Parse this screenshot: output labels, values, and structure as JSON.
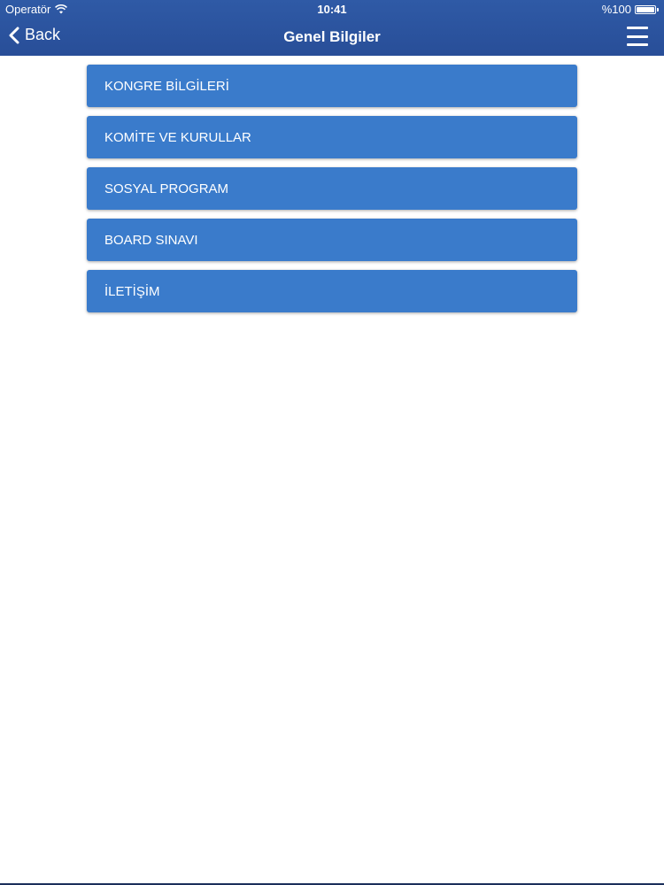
{
  "status_bar": {
    "carrier": "Operatör",
    "time": "10:41",
    "battery": "%100"
  },
  "nav": {
    "back_label": "Back",
    "title": "Genel Bilgiler"
  },
  "menu": {
    "items": [
      {
        "label": "KONGRE BİLGİLERİ"
      },
      {
        "label": "KOMİTE VE KURULLAR"
      },
      {
        "label": "SOSYAL PROGRAM"
      },
      {
        "label": "BOARD SINAVI"
      },
      {
        "label": "İLETİŞİM"
      }
    ]
  },
  "colors": {
    "header": "#2f5aa6",
    "item_background": "#3a7bcb",
    "text": "#ffffff"
  },
  "icons": {
    "back": "chevron-left-icon",
    "menu": "hamburger-menu-icon",
    "wifi": "wifi-icon",
    "battery": "battery-icon"
  }
}
